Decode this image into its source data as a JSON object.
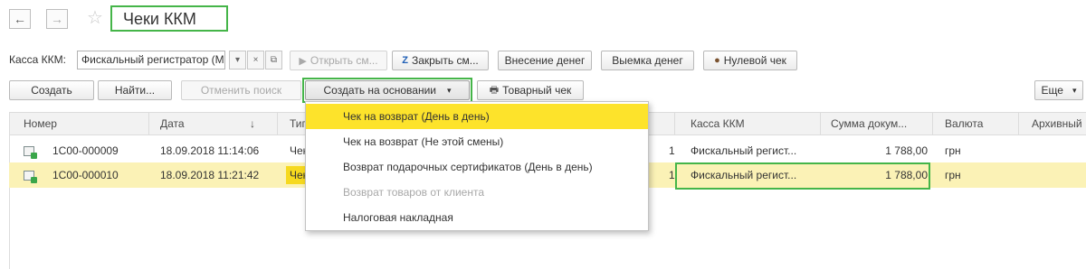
{
  "window": {
    "title": "Чеки ККМ"
  },
  "nav": {
    "back": "←",
    "forward": "→",
    "favorite": "☆"
  },
  "filter": {
    "label": "Касса ККМ:",
    "value": "Фискальный регистратор (М",
    "dropdown_glyph": "▾",
    "clear_glyph": "×",
    "open_glyph": "⧉"
  },
  "toolbar1": {
    "open_shift": "Открыть см...",
    "close_shift": "Закрыть см...",
    "cash_in": "Внесение денег",
    "cash_out": "Выемка денег",
    "zero_check": "Нулевой чек"
  },
  "toolbar2": {
    "create": "Создать",
    "find": "Найти...",
    "cancel_search": "Отменить поиск",
    "create_based": "Создать на основании",
    "goods_check": "Товарный чек",
    "more": "Еще",
    "more_glyph": "▾"
  },
  "based_menu": [
    "Чек на возврат (День в день)",
    "Чек на возврат (Не этой смены)",
    "Возврат подарочных сертификатов (День в день)",
    "Возврат товаров от клиента",
    "Налоговая накладная"
  ],
  "table": {
    "columns": {
      "number": "Номер",
      "date": "Дата",
      "sort_glyph": "↓",
      "type": "Тип",
      "kassa": "Касса ККМ",
      "sum": "Сумма докум...",
      "currency": "Валюта",
      "archive": "Архивный"
    },
    "rows": [
      {
        "number": "1С00-000009",
        "date": "18.09.2018 11:14:06",
        "type": "Чек",
        "shift": "1",
        "kassa": "Фискальный регист...",
        "sum": "1 788,00",
        "currency": "грн"
      },
      {
        "number": "1С00-000010",
        "date": "18.09.2018 11:21:42",
        "type": "Чек",
        "shift": "1",
        "kassa": "Фискальный регист...",
        "sum": "1 788,00",
        "currency": "грн"
      }
    ]
  },
  "colors": {
    "highlight": "#45b549",
    "selection": "#fde32b",
    "row_selected": "#fbf2b6"
  }
}
